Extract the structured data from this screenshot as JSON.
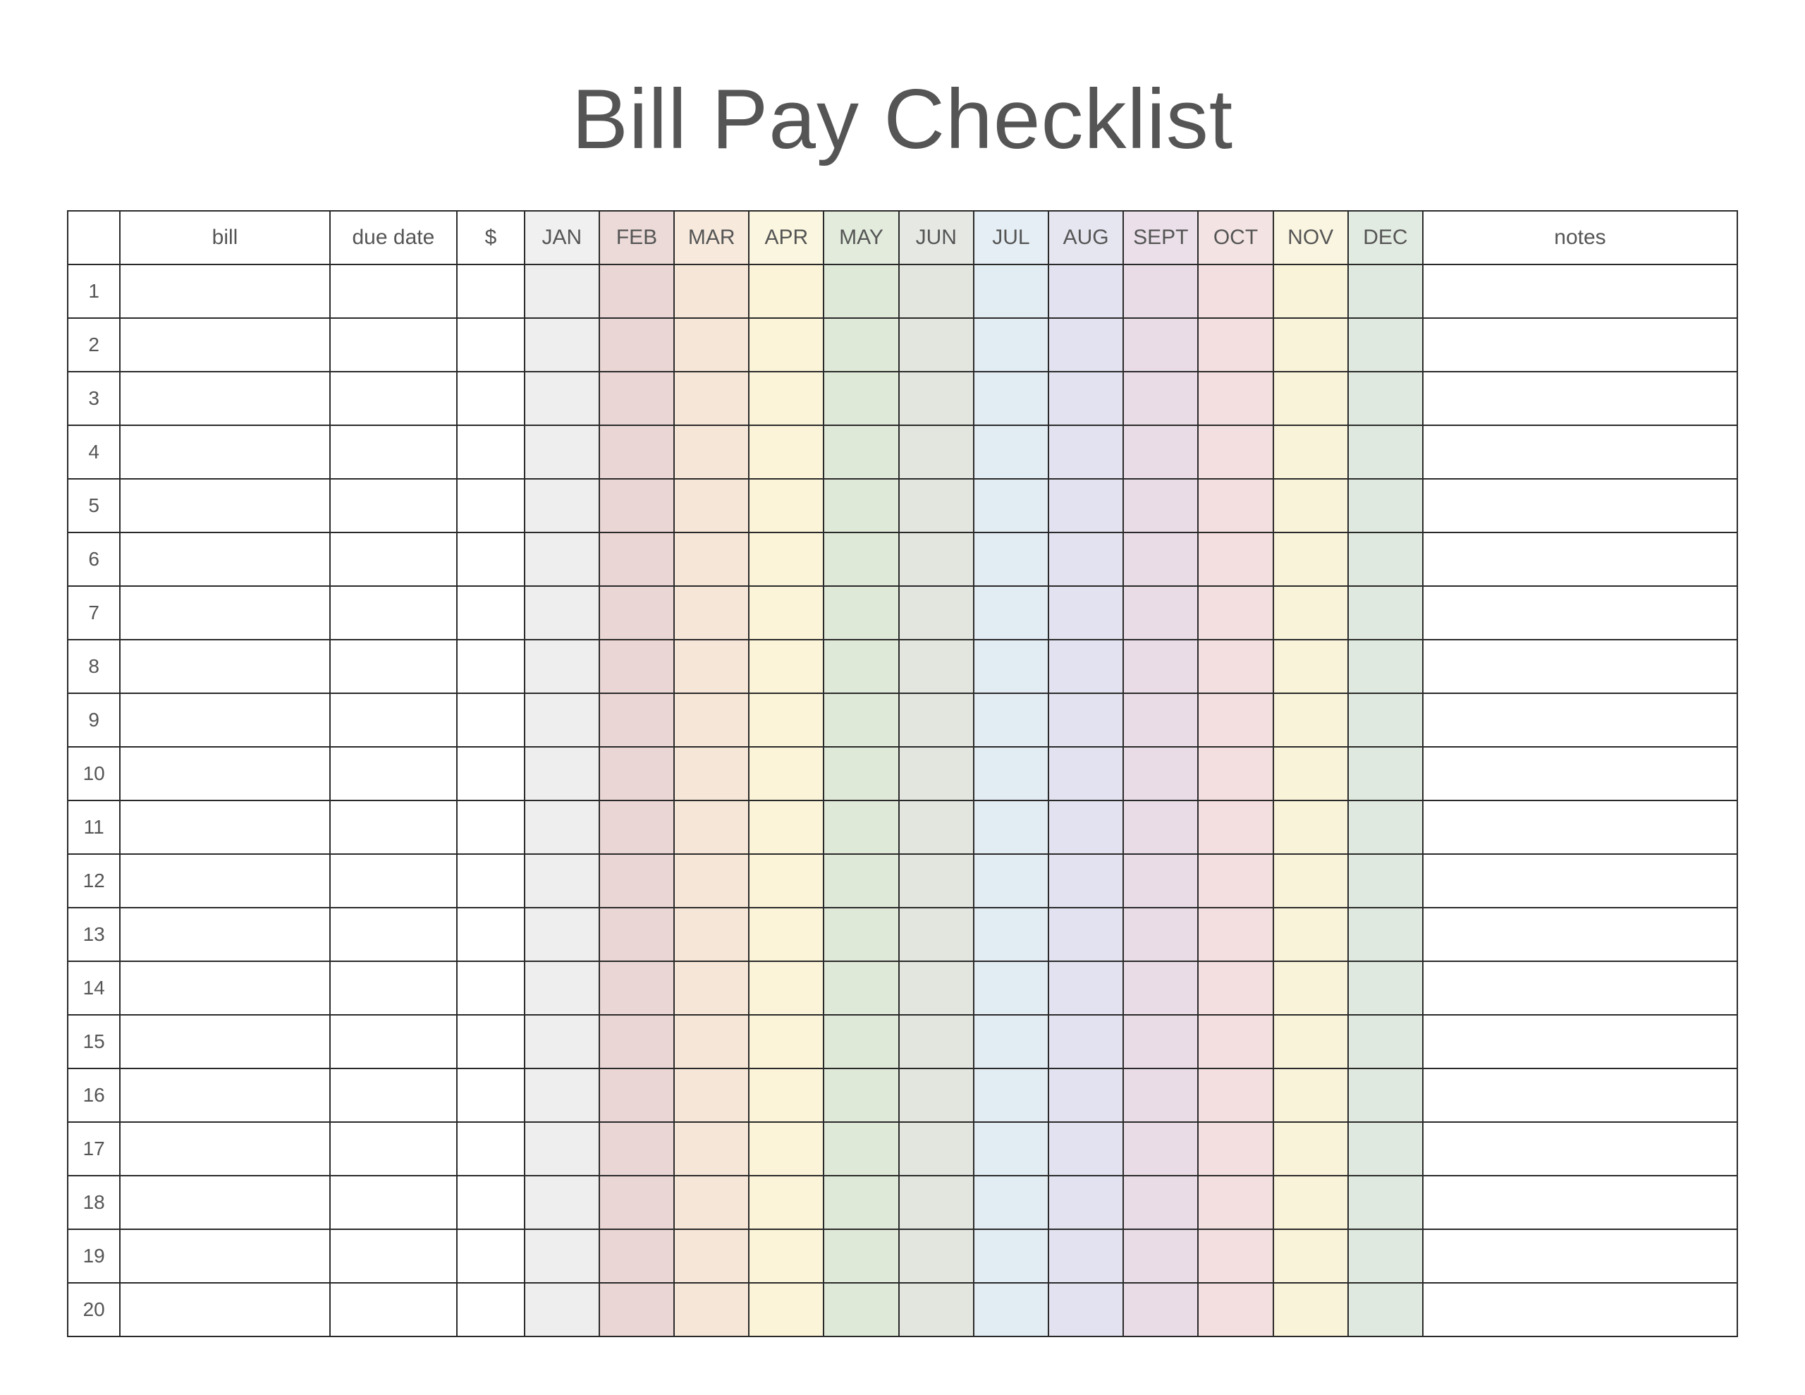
{
  "title": "Bill Pay Checklist",
  "columns": {
    "number": "",
    "bill": "bill",
    "due_date": "due date",
    "amount": "$",
    "months": [
      "JAN",
      "FEB",
      "MAR",
      "APR",
      "MAY",
      "JUN",
      "JUL",
      "AUG",
      "SEPT",
      "OCT",
      "NOV",
      "DEC"
    ],
    "notes": "notes"
  },
  "row_count": 20,
  "month_colors": [
    "#eeeeee",
    "#ead6d4",
    "#f6e6d7",
    "#fbf4d8",
    "#dfe9d8",
    "#e2e6df",
    "#e1ecf3",
    "#e2e2f0",
    "#e9dce6",
    "#f3dfdf",
    "#f9f3da",
    "#dfe9df"
  ]
}
